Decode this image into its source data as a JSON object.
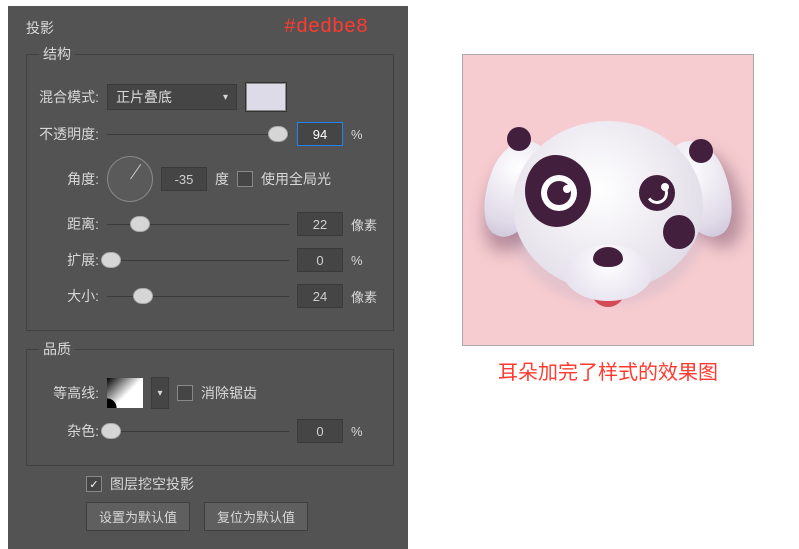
{
  "panel": {
    "title": "投影",
    "annotation": "#dedbe8",
    "structure": {
      "legend": "结构",
      "blend_mode": {
        "label": "混合模式:",
        "value": "正片叠底"
      },
      "color_swatch": "#dedbe8",
      "opacity": {
        "label": "不透明度:",
        "value": "94",
        "unit": "%",
        "handle_pct": 94
      },
      "angle": {
        "label": "角度:",
        "value": "-35",
        "unit": "度",
        "global_label": "使用全局光",
        "global_checked": false
      },
      "distance": {
        "label": "距离:",
        "value": "22",
        "unit": "像素",
        "handle_pct": 18
      },
      "spread": {
        "label": "扩展:",
        "value": "0",
        "unit": "%",
        "handle_pct": 2
      },
      "size": {
        "label": "大小:",
        "value": "24",
        "unit": "像素",
        "handle_pct": 20
      }
    },
    "quality": {
      "legend": "品质",
      "contour": {
        "label": "等高线:",
        "antialias_label": "消除锯齿",
        "antialias_checked": false
      },
      "noise": {
        "label": "杂色:",
        "value": "0",
        "unit": "%",
        "handle_pct": 2
      }
    },
    "knockout": {
      "label": "图层挖空投影",
      "checked": true
    },
    "buttons": {
      "make_default": "设置为默认值",
      "reset_default": "复位为默认值"
    }
  },
  "preview": {
    "caption": "耳朵加完了样式的效果图"
  }
}
